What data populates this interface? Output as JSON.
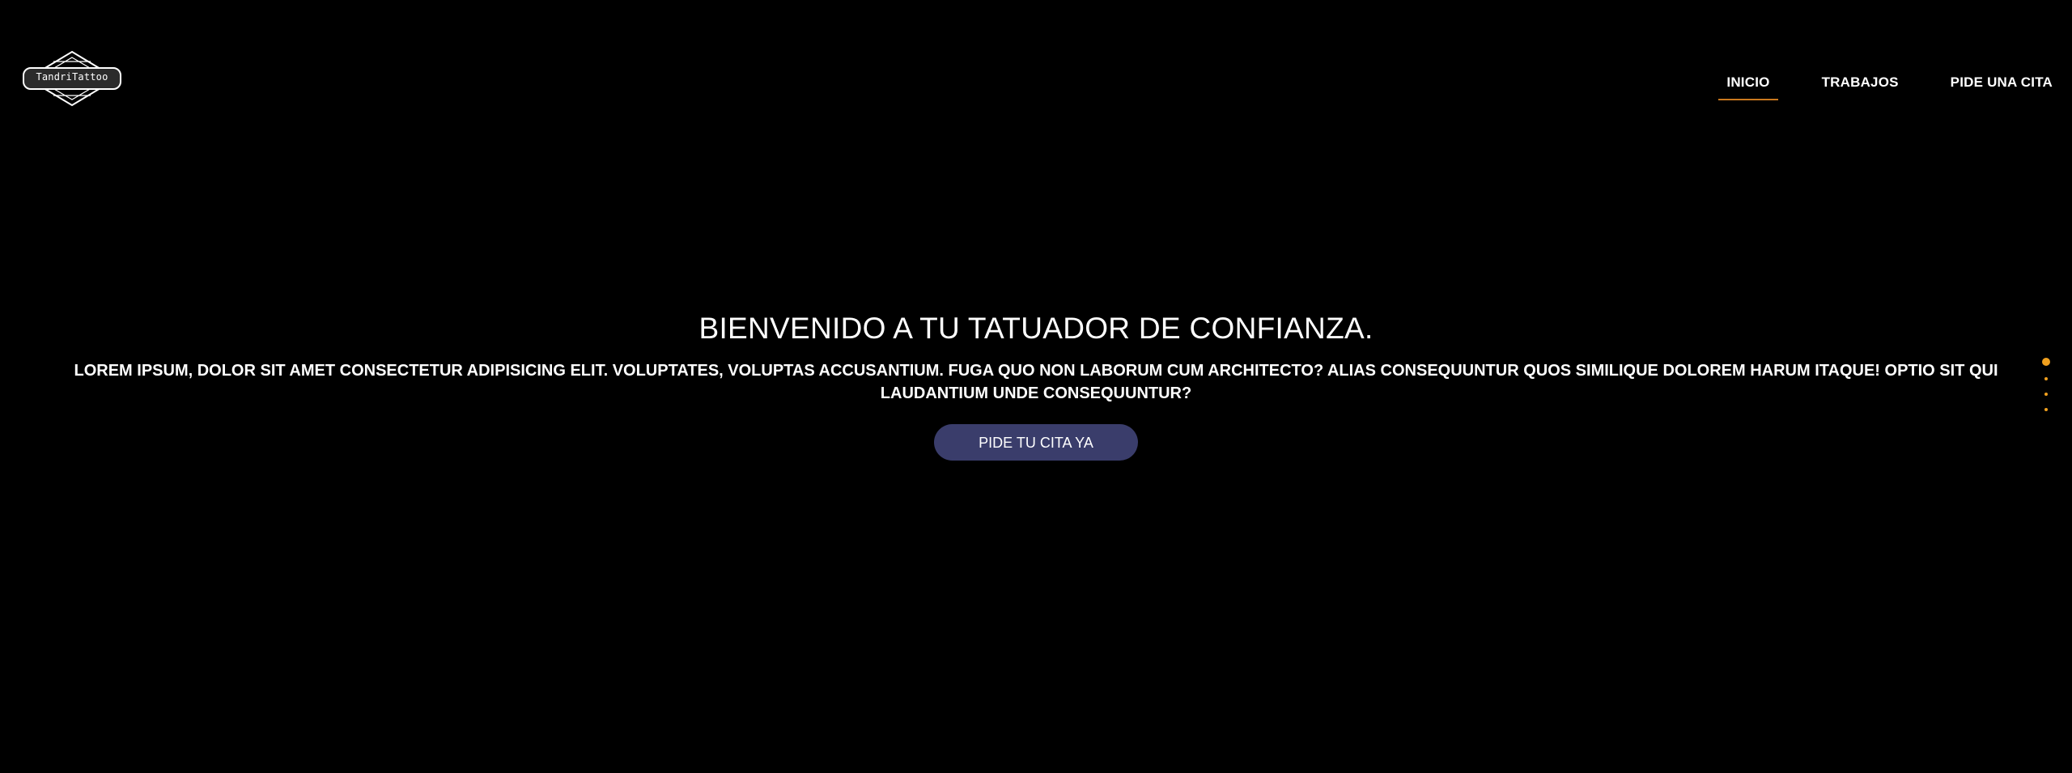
{
  "header": {
    "logo_text": "TandriTattoo",
    "nav": [
      {
        "label": "INICIO",
        "active": true
      },
      {
        "label": "TRABAJOS",
        "active": false
      },
      {
        "label": "PIDE UNA CITA",
        "active": false
      }
    ]
  },
  "hero": {
    "title": "BIENVENIDO A TU TATUADOR DE CONFIANZA.",
    "text": "LOREM IPSUM, DOLOR SIT AMET CONSECTETUR ADIPISICING ELIT. VOLUPTATES, VOLUPTAS ACCUSANTIUM. FUGA QUO NON LABORUM CUM ARCHITECTO? ALIAS CONSEQUUNTUR QUOS SIMILIQUE DOLOREM HARUM ITAQUE! OPTIO SIT QUI LAUDANTIUM UNDE CONSEQUUNTUR?",
    "cta_label": "PIDE TU CITA YA"
  },
  "slide_indicator": {
    "count": 4,
    "active_index": 0
  },
  "colors": {
    "background": "#000000",
    "accent": "#f0a01e",
    "nav_underline": "#c8781e",
    "button": "#3a3d6b",
    "text": "#ffffff"
  },
  "icons": {
    "logo": "diamond-badge-logo-icon"
  }
}
